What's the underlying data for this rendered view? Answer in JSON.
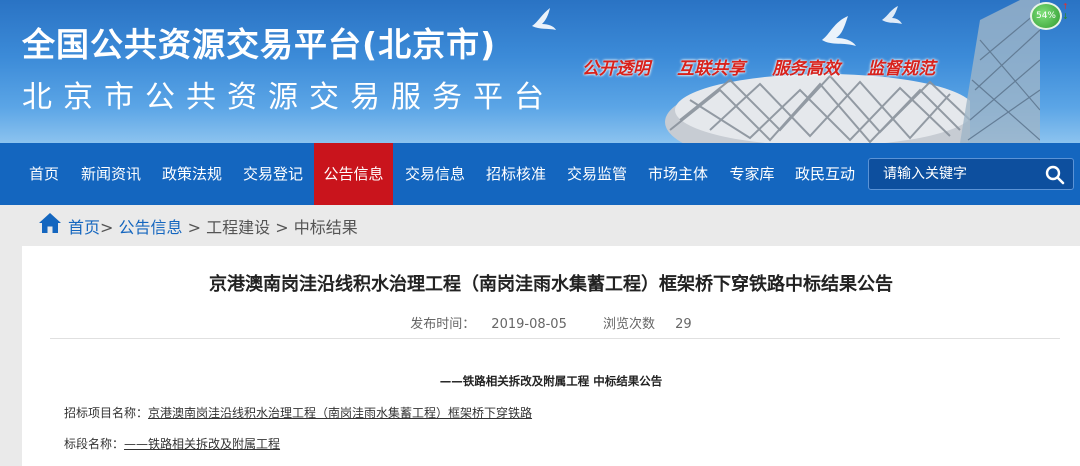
{
  "header": {
    "title_main": "全国公共资源交易平台(北京市)",
    "title_sub": "北京市公共资源交易服务平台",
    "slogans": [
      "公开透明",
      "互联共享",
      "服务高效",
      "监督规范"
    ],
    "badge_percent": "54%",
    "badge_up": "↑",
    "badge_down": "↓",
    "brand_color": "#1466bf",
    "active_color": "#c9141c"
  },
  "nav": {
    "items": [
      {
        "label": "首页"
      },
      {
        "label": "新闻资讯"
      },
      {
        "label": "政策法规"
      },
      {
        "label": "交易登记"
      },
      {
        "label": "公告信息",
        "active": true
      },
      {
        "label": "交易信息"
      },
      {
        "label": "招标核准"
      },
      {
        "label": "交易监管"
      },
      {
        "label": "市场主体"
      },
      {
        "label": "专家库"
      },
      {
        "label": "政民互动"
      }
    ],
    "search_placeholder": "请输入关键字"
  },
  "breadcrumb": {
    "home": "首页",
    "sep1": ">",
    "level1": "公告信息",
    "sep2": " > ",
    "level2": "工程建设",
    "sep3": " > ",
    "level3": "中标结果"
  },
  "article": {
    "title": "京港澳南岗洼沿线积水治理工程（南岗洼雨水集蓄工程）框架桥下穿铁路中标结果公告",
    "publish_label": "发布时间：",
    "publish_date": "2019-08-05",
    "views_label": "浏览次数",
    "views_count": "29",
    "sub_heading": "——铁路相关拆改及附属工程 中标结果公告",
    "project_label": "招标项目名称：",
    "project_value": "京港澳南岗洼沿线积水治理工程（南岗洼雨水集蓄工程）框架桥下穿铁路",
    "section_label": "标段名称：",
    "section_value": "——铁路相关拆改及附属工程"
  }
}
